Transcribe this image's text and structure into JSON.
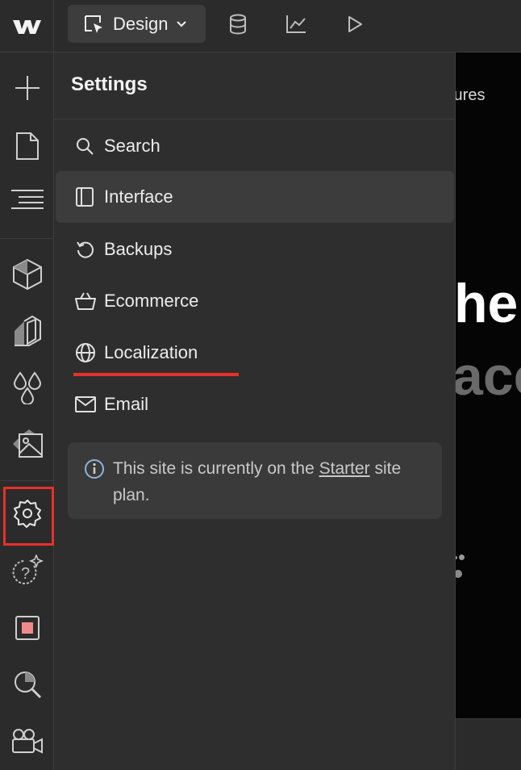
{
  "topbar": {
    "mode_label": "Design",
    "icons": [
      "webflow-logo-icon",
      "cursor-box-icon",
      "chevron-down-icon",
      "cms-database-icon",
      "analytics-chart-icon",
      "preview-play-icon"
    ]
  },
  "rail": {
    "icons": [
      "add-icon",
      "pages-icon",
      "navigator-icon",
      "components-icon",
      "style-selectors-icon",
      "variables-icon",
      "assets-icon",
      "settings-icon",
      "help-ai-icon",
      "stop-record-icon",
      "audit-search-icon",
      "video-icon"
    ]
  },
  "settings": {
    "title": "Settings",
    "items": [
      {
        "label": "Search",
        "icon": "search-icon"
      },
      {
        "label": "Interface",
        "icon": "interface-panel-icon"
      },
      {
        "label": "Backups",
        "icon": "backup-restore-icon"
      },
      {
        "label": "Ecommerce",
        "icon": "basket-icon"
      },
      {
        "label": "Localization",
        "icon": "globe-icon"
      },
      {
        "label": "Email",
        "icon": "mail-icon"
      }
    ],
    "active_item": "Interface",
    "notice": {
      "prefix": "This site is currently on the ",
      "link": "Starter",
      "suffix": " site plan."
    }
  },
  "canvas": {
    "text_top": "tures",
    "text_big": "he",
    "text_grey": "ace"
  },
  "colors": {
    "background": "#2b2b2b",
    "panel": "#2e2e2e",
    "accent_red": "#e8302a",
    "active_item": "#3c3c3c"
  }
}
